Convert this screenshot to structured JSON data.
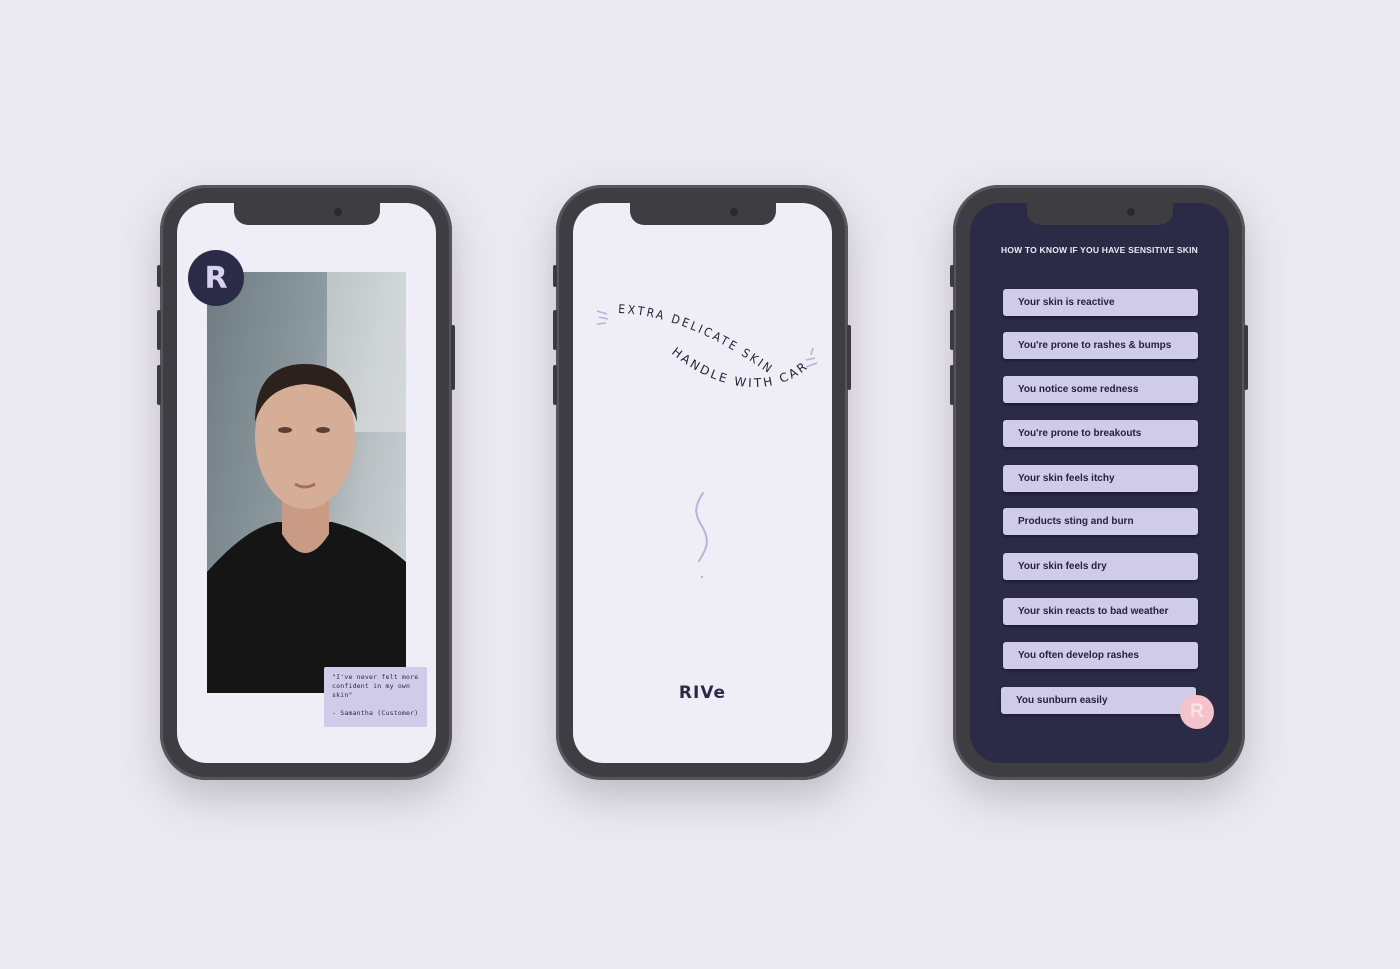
{
  "phone1": {
    "badge_letter": "R",
    "quote": "\"I've never felt more confident in my own skin\"",
    "attribution": "- Samantha (Customer)"
  },
  "phone2": {
    "line1": "EXTRA DELICATE SKIN",
    "line2": "HANDLE WITH CARE",
    "logo": "RIVe",
    "accent": "#b7b2e0"
  },
  "phone3": {
    "title": "HOW TO KNOW IF YOU HAVE SENSITIVE SKIN",
    "items": [
      "Your skin is reactive",
      "You're prone to rashes & bumps",
      "You notice some redness",
      "You're prone to breakouts",
      "Your skin feels itchy",
      "Products sting and burn",
      "Your skin feels dry",
      "Your skin reacts to bad weather",
      "You often develop rashes",
      "You sunburn easily"
    ],
    "badge_letter": "R",
    "colors": {
      "background": "#2b2b48",
      "card": "#cfcbe8",
      "badge": "#f4c3cb"
    }
  }
}
